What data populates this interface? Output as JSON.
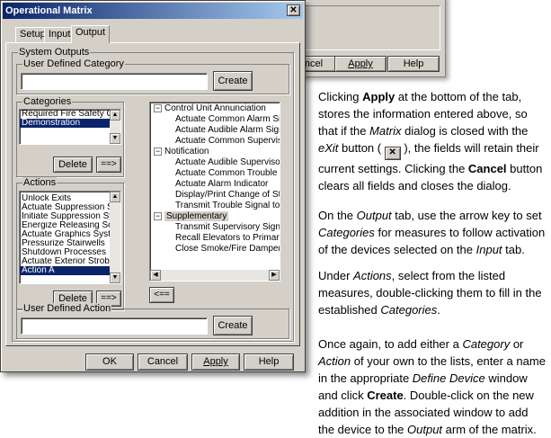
{
  "background_dialog": {
    "buttons": [
      {
        "label": "Cancel",
        "display": "ncel"
      },
      {
        "label": "Apply"
      },
      {
        "label": "Help"
      }
    ]
  },
  "dialog": {
    "title": "Operational Matrix",
    "close_icon": "close-x-icon",
    "tabs": [
      {
        "label": "Setup"
      },
      {
        "label": "Input"
      },
      {
        "label": "Output",
        "active": true
      }
    ],
    "system_outputs_label": "System Outputs",
    "user_defined_category": {
      "label": "User Defined Category",
      "value": "",
      "create_label": "Create"
    },
    "categories": {
      "label": "Categories",
      "items": [
        "Required Fire Safety Control",
        "Demonstration"
      ],
      "selected_index": 1,
      "delete_label": "Delete",
      "move_label": "==>"
    },
    "actions": {
      "label": "Actions",
      "items": [
        "Unlock Exits",
        "Actuate Suppression System F",
        "Initiate Suppression System F",
        "Energize Releasing Solenoid",
        "Actuate Graphics System - D",
        "Pressurize Stairwells",
        "Shutdown Processes",
        "Actuate Exterior Strobe at F",
        "Action A"
      ],
      "selected_index": 8,
      "delete_label": "Delete",
      "move_label": "==>"
    },
    "tree": {
      "groups": [
        {
          "label": "Control Unit Annunciation",
          "children": [
            "Actuate Common Alarm Signal I",
            "Actuate Audible Alarm Signal",
            "Actuate Common Supervisory S"
          ]
        },
        {
          "label": "Notification",
          "children": [
            "Actuate Audible Supervisory Sig",
            "Actuate Common Trouble Signa",
            "Actuate Alarm Indicator",
            "Display/Print Change of Status",
            "Transmit Trouble Signal to Supe"
          ]
        },
        {
          "label": "Supplementary",
          "children": [
            "Transmit Supervisory Signal to S",
            "Recall Elevators to Primary Rec",
            "Close Smoke/Fire Dampers in F"
          ],
          "selected": true
        }
      ],
      "expand_glyph": "−",
      "back_label": "<=="
    },
    "user_defined_action": {
      "label": "User Defined Action",
      "value": "",
      "create_label": "Create"
    },
    "footer_buttons": [
      {
        "label": "OK"
      },
      {
        "label": "Cancel"
      },
      {
        "label": "Apply"
      },
      {
        "label": "Help"
      }
    ]
  },
  "text": {
    "p1": [
      {
        "t": "Clicking "
      },
      {
        "t": "Apply",
        "b": true
      },
      {
        "t": " at the bottom of the tab, stores the information entered above, so that if the "
      },
      {
        "t": "Matrix",
        "i": true
      },
      {
        "t": " dialog is closed with the "
      },
      {
        "t": "eXit",
        "i": true
      },
      {
        "t": " button ( "
      },
      {
        "x": true
      },
      {
        "t": " ), the fields will retain their current settings. Clicking the "
      },
      {
        "t": "Cancel",
        "b": true
      },
      {
        "t": " button clears all fields and closes the dialog."
      }
    ],
    "p2": [
      {
        "t": "On the "
      },
      {
        "t": "Output",
        "i": true
      },
      {
        "t": " tab, use the arrow key to set "
      },
      {
        "t": "Categories",
        "i": true
      },
      {
        "t": " for measures to follow activation of the devices selected on the "
      },
      {
        "t": "Input",
        "i": true
      },
      {
        "t": " tab."
      }
    ],
    "p3": [
      {
        "t": "Under "
      },
      {
        "t": "Actions",
        "i": true
      },
      {
        "t": ", select from the listed measures, double-clicking them to fill in the established "
      },
      {
        "t": "Categories",
        "i": true
      },
      {
        "t": "."
      }
    ],
    "p4": [
      {
        "t": "Once again, to add either a "
      },
      {
        "t": "Category",
        "i": true
      },
      {
        "t": " or "
      },
      {
        "t": "Action",
        "i": true
      },
      {
        "t": " of your own to the lists, enter a name in the appropriate "
      },
      {
        "t": "Define Device",
        "i": true
      },
      {
        "t": " window and click "
      },
      {
        "t": "Create",
        "b": true
      },
      {
        "t": ". Double-click on the new addition in the associated window to add the device to the "
      },
      {
        "t": "Output",
        "i": true
      },
      {
        "t": " arm of the matrix."
      }
    ],
    "close_glyph": "✕"
  }
}
